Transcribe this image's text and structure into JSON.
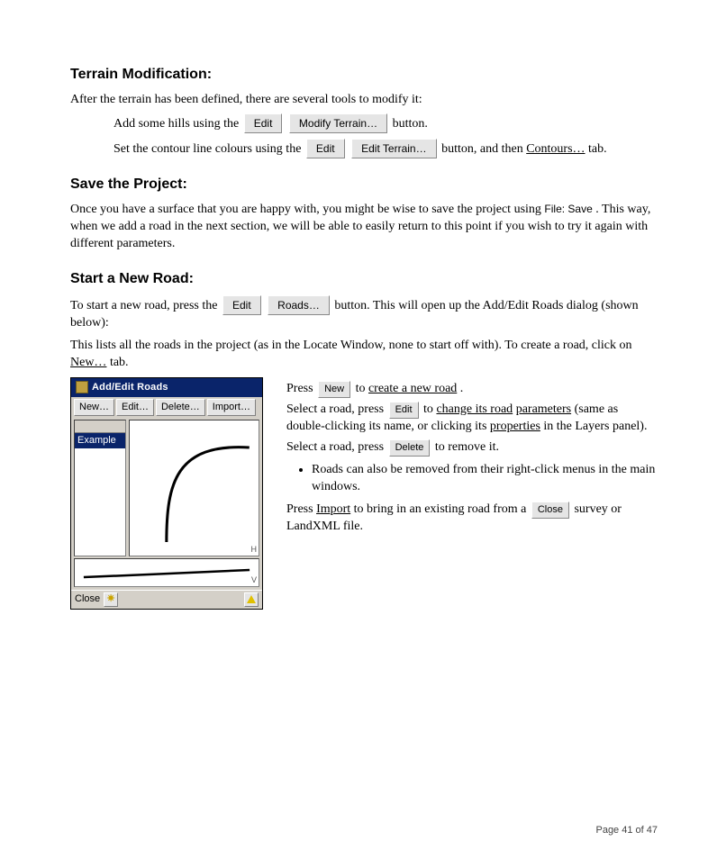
{
  "sections": {
    "terrain_title": "Terrain Modification:",
    "after_terrain": "After the terrain has been defined, there are several tools to modify it:",
    "hills_line_prefix": "Add some hills using the ",
    "edit_btn_1": "Edit",
    "modify_terrain_btn": "Modify Terrain…",
    "hills_line_suffix": " button.",
    "contour_line_prefix": "Set the contour line colours using the ",
    "edit_btn_2": "Edit",
    "edit_terrain_btn": "Edit Terrain…",
    "contour_line_mid": " button, and then ",
    "contours_tab": "Contours…",
    "contour_line_suffix": " tab.",
    "save_title": "Save the Project:",
    "save_p1_before": "Once you have a surface that you are happy with, you might be wise to save the project using ",
    "file_save": "File: Save",
    "save_p1_after": ".  This way, when we add a road in the next section, we will be able to easily return to this point if you wish to try it again with different parameters.",
    "newroad_title": "Start a New Road:",
    "newroad_line_prefix": "To start a new road, press the ",
    "edit_btn_3": "Edit",
    "roads_btn": "Roads…",
    "newroad_line_suffix": " button.  This will open up the Add/Edit Roads dialog (shown below):",
    "addedit_line_prefix": "This lists all the roads in the project (as in the Locate Window, none to start off with).  To create a road, click on ",
    "new_tab": "New…",
    "addedit_line_suffix": " tab.",
    "dialogtitle": "Add/Edit Roads",
    "tb_new": "New…",
    "tb_edit": "Edit…",
    "tb_delete": "Delete…",
    "tb_import": "Import…",
    "list_item": "Example",
    "close_lbl": "Close",
    "rc_p1_before": "Press ",
    "btn_new": "New",
    "rc_p1_mid": " to ",
    "u_create_new_road": "create a new road",
    "rc_p1_after": ".",
    "rc_p2_before": "Select a road, press ",
    "btn_edit": "Edit",
    "rc_p2_mid": " to ",
    "u_change_road": "change its road",
    "u_parameters": "parameters",
    "rc_p2_mid2": " (same as double-clicking its name, or clicking its ",
    "u_properties": "properties",
    "rc_p2_after": " in the Layers panel).",
    "rc_p3_before": "Select a road, press ",
    "btn_delete": "Delete",
    "rc_p3_after": " to remove it.",
    "bullet_1": "Roads can also be removed from their right-click menus in the main windows.",
    "rc_p4_before": "Press ",
    "u_import": "Import",
    "rc_p4_mid": " to bring in an existing road from a ",
    "btn_close": "Close",
    "rc_p4_after": " survey or LandXML file.",
    "footer_page": "Page 41 of 47"
  }
}
